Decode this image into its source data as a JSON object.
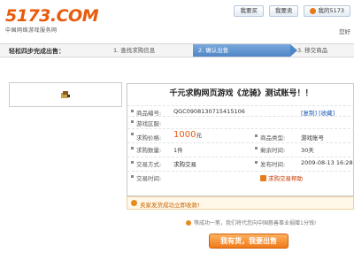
{
  "logo": {
    "main": "5173",
    "com": ".COM",
    "subtitle": "中国网络游戏服务网"
  },
  "top_buttons": {
    "buy": "我要买",
    "sell": "我要卖",
    "home": "我的5173"
  },
  "welcome": "您好",
  "steps": {
    "title": "轻松四步完成出售：",
    "step1": "1. 查找求购信息",
    "step2": "2. 确认出售",
    "step3": "3. 移交商品"
  },
  "listing": {
    "title": "千元求购网页游戏《龙骑》测试账号！！",
    "id_label": "商品编号:",
    "id_value": "QGC0908130715415106",
    "links": "[复制] [收藏]",
    "region_label": "游戏区服:",
    "region_value": "",
    "price_label": "求购价格:",
    "price_value": "1000",
    "price_unit": "元",
    "type_label": "商品类型:",
    "type_value": "游戏账号",
    "qty_label": "求购数量:",
    "qty_value": "1件",
    "remain_label": "剩余时间:",
    "remain_value": "30天",
    "method_label": "交易方式:",
    "method_value": "求购交易",
    "pubtime_label": "发布时间:",
    "pubtime_value": "2009-08-13 16:28",
    "tradetime_label": "交易时间:",
    "tradetime_value": "",
    "help": "求购交易帮助"
  },
  "notice": "卖家发货成功立即收款!",
  "hint": "等成功一笔，我们将代您向中国慈善事业捐赠1分钱!",
  "sell_button": "我有货，我要出售",
  "colors": {
    "accent": "#e85a0c",
    "step_active": "#4f86c6",
    "link": "#1a58b5"
  }
}
